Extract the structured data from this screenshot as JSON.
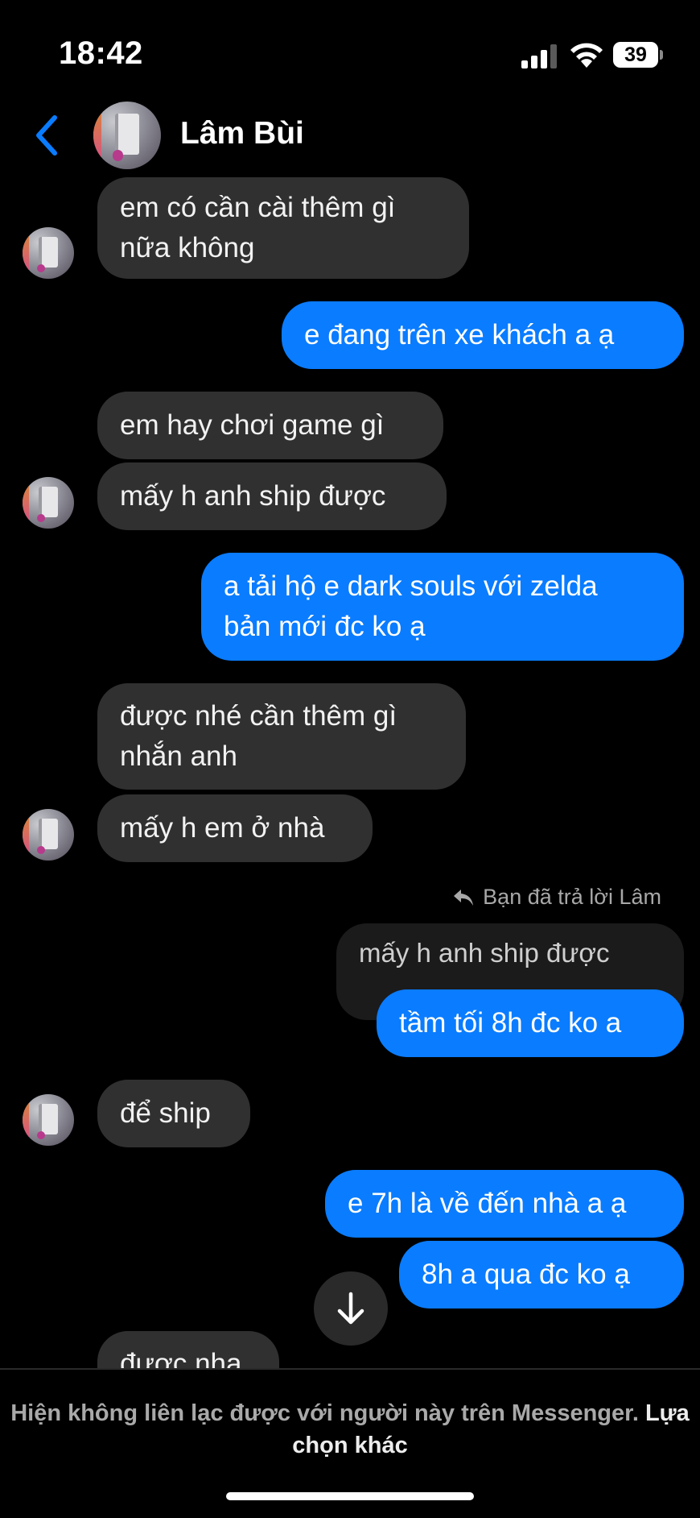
{
  "status_bar": {
    "time": "18:42",
    "battery": "39"
  },
  "header": {
    "contact_name": "Lâm Bùi"
  },
  "messages": [
    {
      "lines": [
        "em có cần cài thêm gì",
        "nữa không"
      ]
    },
    {
      "lines": [
        "e đang trên xe khách a ạ"
      ]
    },
    {
      "lines": [
        "em hay chơi game gì"
      ]
    },
    {
      "lines": [
        "mấy h anh ship được"
      ]
    },
    {
      "lines": [
        "a tải hộ e dark souls với zelda",
        "bản mới đc ko ạ"
      ]
    },
    {
      "lines": [
        "được nhé cần thêm gì",
        "nhắn anh"
      ]
    },
    {
      "lines": [
        "mấy h em ở nhà"
      ]
    },
    {
      "lines": [
        "mấy h anh ship được"
      ]
    },
    {
      "lines": [
        "tầm tối 8h đc ko a"
      ]
    },
    {
      "lines": [
        "để ship"
      ]
    },
    {
      "lines": [
        "e 7h là về đến nhà a ạ"
      ]
    },
    {
      "lines": [
        "8h a qua đc ko ạ"
      ]
    },
    {
      "lines": [
        "được nha"
      ]
    }
  ],
  "reply_indicator": "Bạn đã trả lời Lâm",
  "notice": {
    "text": "Hiện không liên lạc được với người này trên Messenger.",
    "link": "Lựa chọn khác"
  }
}
